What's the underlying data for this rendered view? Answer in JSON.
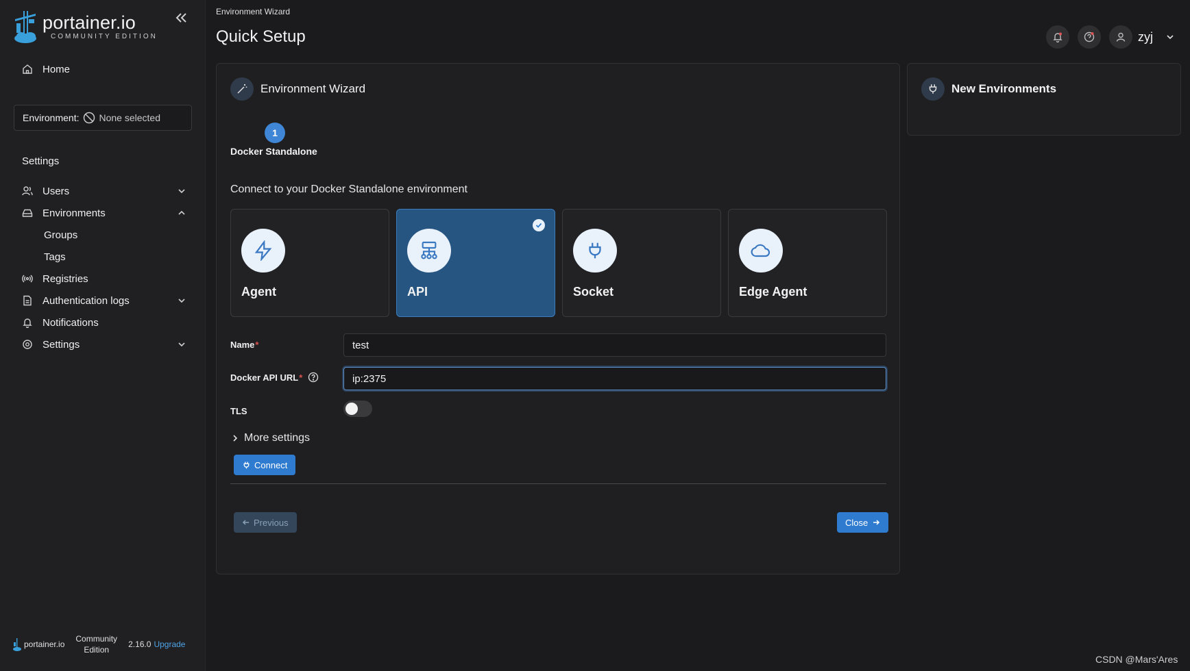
{
  "sidebar": {
    "logo_main": "portainer.io",
    "logo_sub": "COMMUNITY EDITION",
    "home": "Home",
    "environment_label": "Environment:",
    "environment_value": "None selected",
    "settings_heading": "Settings",
    "items": {
      "users": "Users",
      "environments": "Environments",
      "groups": "Groups",
      "tags": "Tags",
      "registries": "Registries",
      "auth_logs": "Authentication logs",
      "notifications": "Notifications",
      "settings": "Settings"
    },
    "footer": {
      "brand": "portainer.io",
      "edition_line1": "Community",
      "edition_line2": "Edition",
      "version": "2.16.0",
      "upgrade": "Upgrade"
    }
  },
  "header": {
    "breadcrumb": "Environment Wizard",
    "title": "Quick Setup",
    "username": "zyj"
  },
  "wizard": {
    "title": "Environment Wizard",
    "step_number": "1",
    "step_label": "Docker Standalone",
    "connect_title": "Connect to your Docker Standalone environment",
    "options": [
      "Agent",
      "API",
      "Socket",
      "Edge Agent"
    ],
    "selected_option": "API",
    "form": {
      "name_label": "Name",
      "name_value": "test",
      "url_label": "Docker API URL",
      "url_value": "ip:2375",
      "tls_label": "TLS",
      "tls_enabled": false
    },
    "more_settings": "More settings",
    "connect_button": "Connect",
    "previous_button": "Previous",
    "close_button": "Close"
  },
  "new_environments": {
    "title": "New Environments"
  },
  "watermark": "CSDN @Mars'Ares",
  "colors": {
    "accent": "#2e7bd0",
    "selected_card": "#275582",
    "background": "#1b1b1d"
  }
}
